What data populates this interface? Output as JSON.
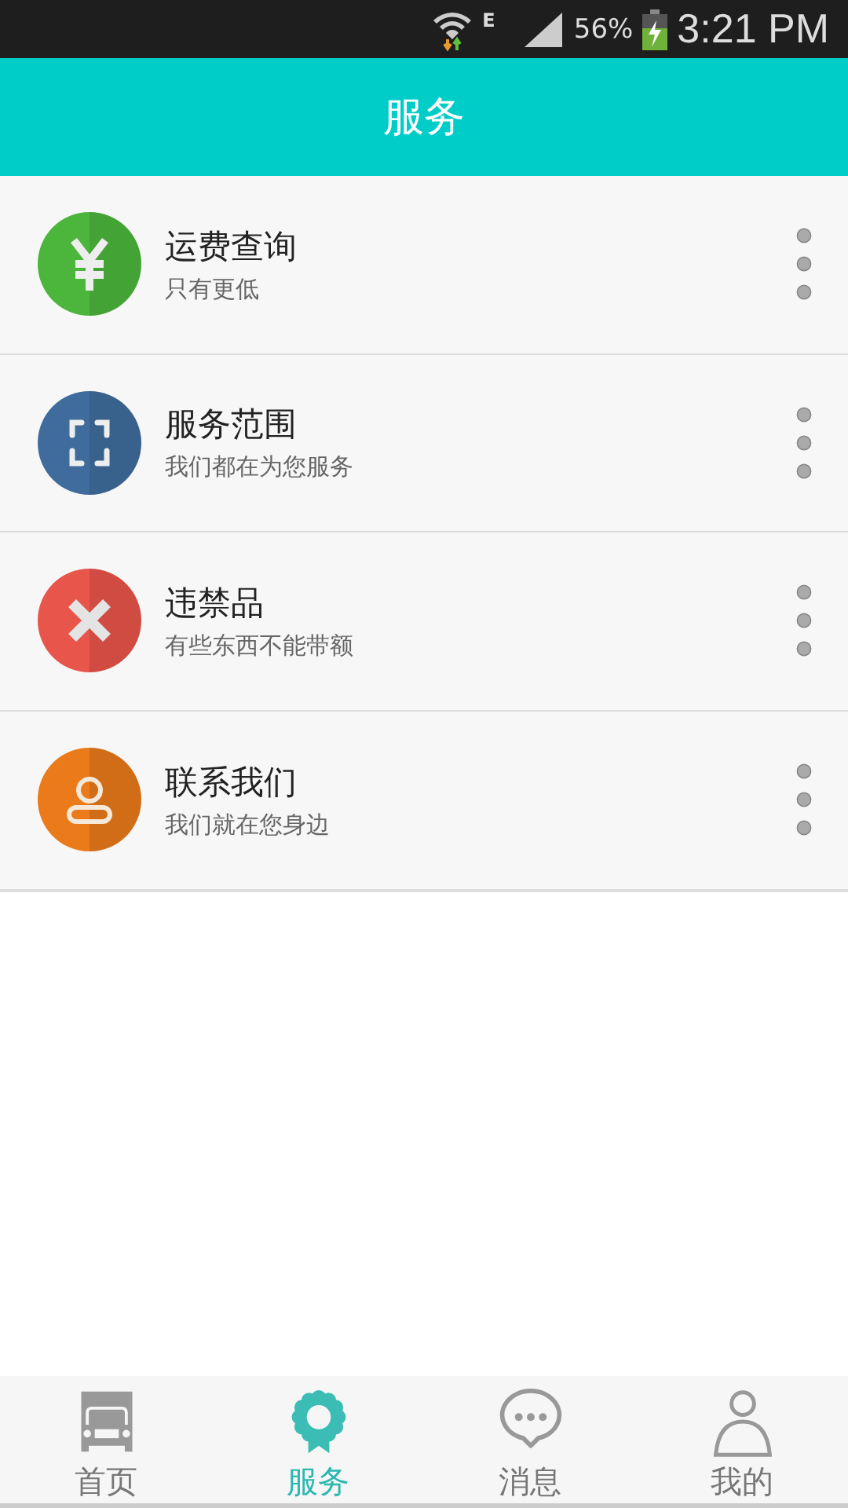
{
  "status_bar": {
    "network": "E",
    "battery": "56%",
    "time": "3:21 PM"
  },
  "header": {
    "title": "服务"
  },
  "items": [
    {
      "kind": "yen",
      "color": "#4cb63c",
      "title": "运费查询",
      "subtitle": "只有更低"
    },
    {
      "kind": "scan",
      "color": "#3f6c9c",
      "title": "服务范围",
      "subtitle": "我们都在为您服务"
    },
    {
      "kind": "cross",
      "color": "#e8554b",
      "title": "违禁品",
      "subtitle": "有些东西不能带额"
    },
    {
      "kind": "person",
      "color": "#ea7a1a",
      "title": "联系我们",
      "subtitle": "我们就在您身边"
    }
  ],
  "tabs": [
    {
      "kind": "truck",
      "label": "首页",
      "selected": false
    },
    {
      "kind": "badge",
      "label": "服务",
      "selected": true
    },
    {
      "kind": "chat",
      "label": "消息",
      "selected": false
    },
    {
      "kind": "person",
      "label": "我的",
      "selected": false
    }
  ]
}
